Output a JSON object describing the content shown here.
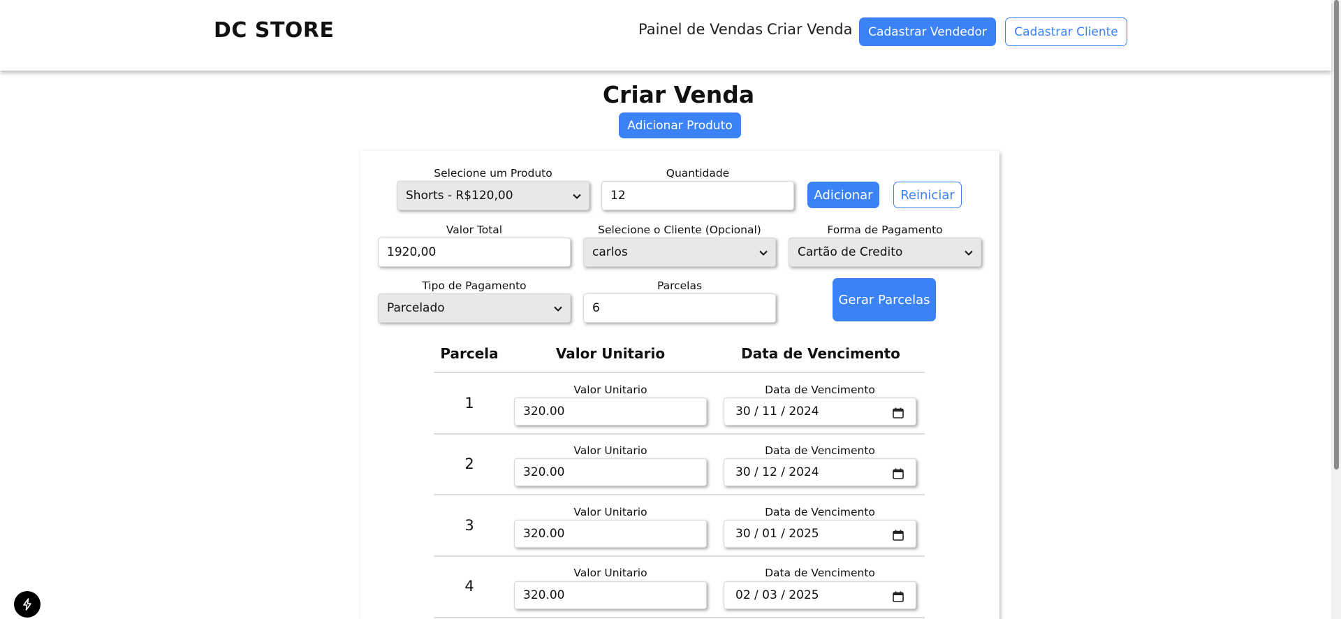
{
  "header": {
    "brand": "DC STORE",
    "nav": {
      "painel": "Painel de Vendas",
      "criar": "Criar Venda",
      "cadastrar_vendedor": "Cadastrar Vendedor",
      "cadastrar_cliente": "Cadastrar Cliente"
    }
  },
  "page": {
    "title": "Criar Venda",
    "add_product_label": "Adicionar Produto"
  },
  "form": {
    "produto": {
      "label": "Selecione um Produto",
      "value": "Shorts - R$120,00"
    },
    "quantidade": {
      "label": "Quantidade",
      "value": "12"
    },
    "adicionar_label": "Adicionar",
    "reiniciar_label": "Reiniciar",
    "valor_total": {
      "label": "Valor Total",
      "value": "1920,00"
    },
    "cliente": {
      "label": "Selecione o Cliente (Opcional)",
      "value": "carlos"
    },
    "forma_pagamento": {
      "label": "Forma de Pagamento",
      "value": "Cartão de Credito"
    },
    "tipo_pagamento": {
      "label": "Tipo de Pagamento",
      "value": "Parcelado"
    },
    "parcelas": {
      "label": "Parcelas",
      "value": "6"
    },
    "gerar_label": "Gerar Parcelas"
  },
  "table": {
    "headers": [
      "Parcela",
      "Valor Unitario",
      "Data de Vencimento"
    ],
    "field_label_valor": "Valor Unitario",
    "field_label_data": "Data de Vencimento",
    "rows": [
      {
        "parcela": "1",
        "valor": "320.00",
        "data": "30 / 11 / 2024"
      },
      {
        "parcela": "2",
        "valor": "320.00",
        "data": "30 / 12 / 2024"
      },
      {
        "parcela": "3",
        "valor": "320.00",
        "data": "30 / 01 / 2025"
      },
      {
        "parcela": "4",
        "valor": "320.00",
        "data": "02 / 03 / 2025"
      }
    ]
  },
  "colors": {
    "accent": "#3b82f6"
  },
  "icons": {
    "select": "chevron-down-icon",
    "date": "calendar-icon",
    "fab": "lightning-icon"
  }
}
